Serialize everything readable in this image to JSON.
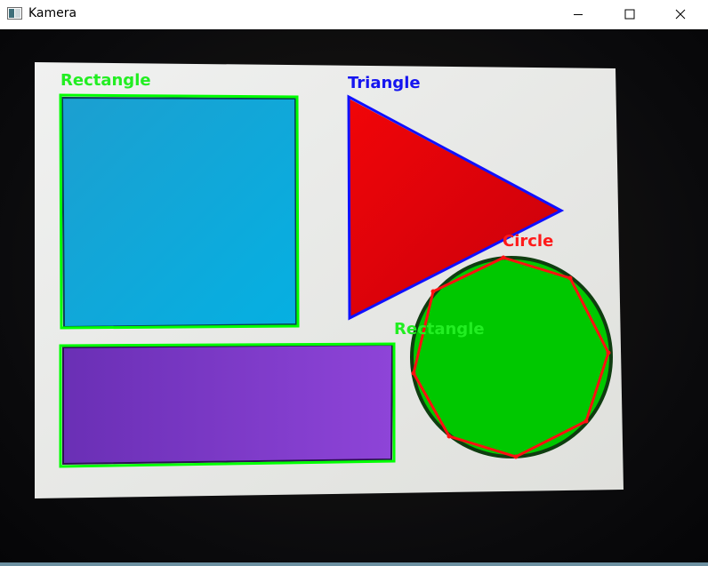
{
  "window": {
    "title": "Kamera",
    "app_icon": "camera-window-icon",
    "controls": {
      "minimize_icon": "minimize-icon",
      "maximize_icon": "maximize-icon",
      "close_icon": "close-icon"
    }
  },
  "detections": [
    {
      "label": "Rectangle",
      "shape_color": "#10a4d8",
      "outline_color": "#00ff00"
    },
    {
      "label": "Triangle",
      "shape_color": "#e8000a",
      "outline_color": "#1010ff"
    },
    {
      "label": "Circle",
      "shape_color": "#00c800",
      "outline_color": "#ff1010"
    },
    {
      "label": "Rectangle",
      "shape_color": "#7b3cc8",
      "outline_color": "#00ff00"
    }
  ],
  "colors": {
    "paper": "#e9ebea",
    "label_green": "#22ee22",
    "label_blue": "#1515f0",
    "label_red": "#ff1a1a"
  }
}
